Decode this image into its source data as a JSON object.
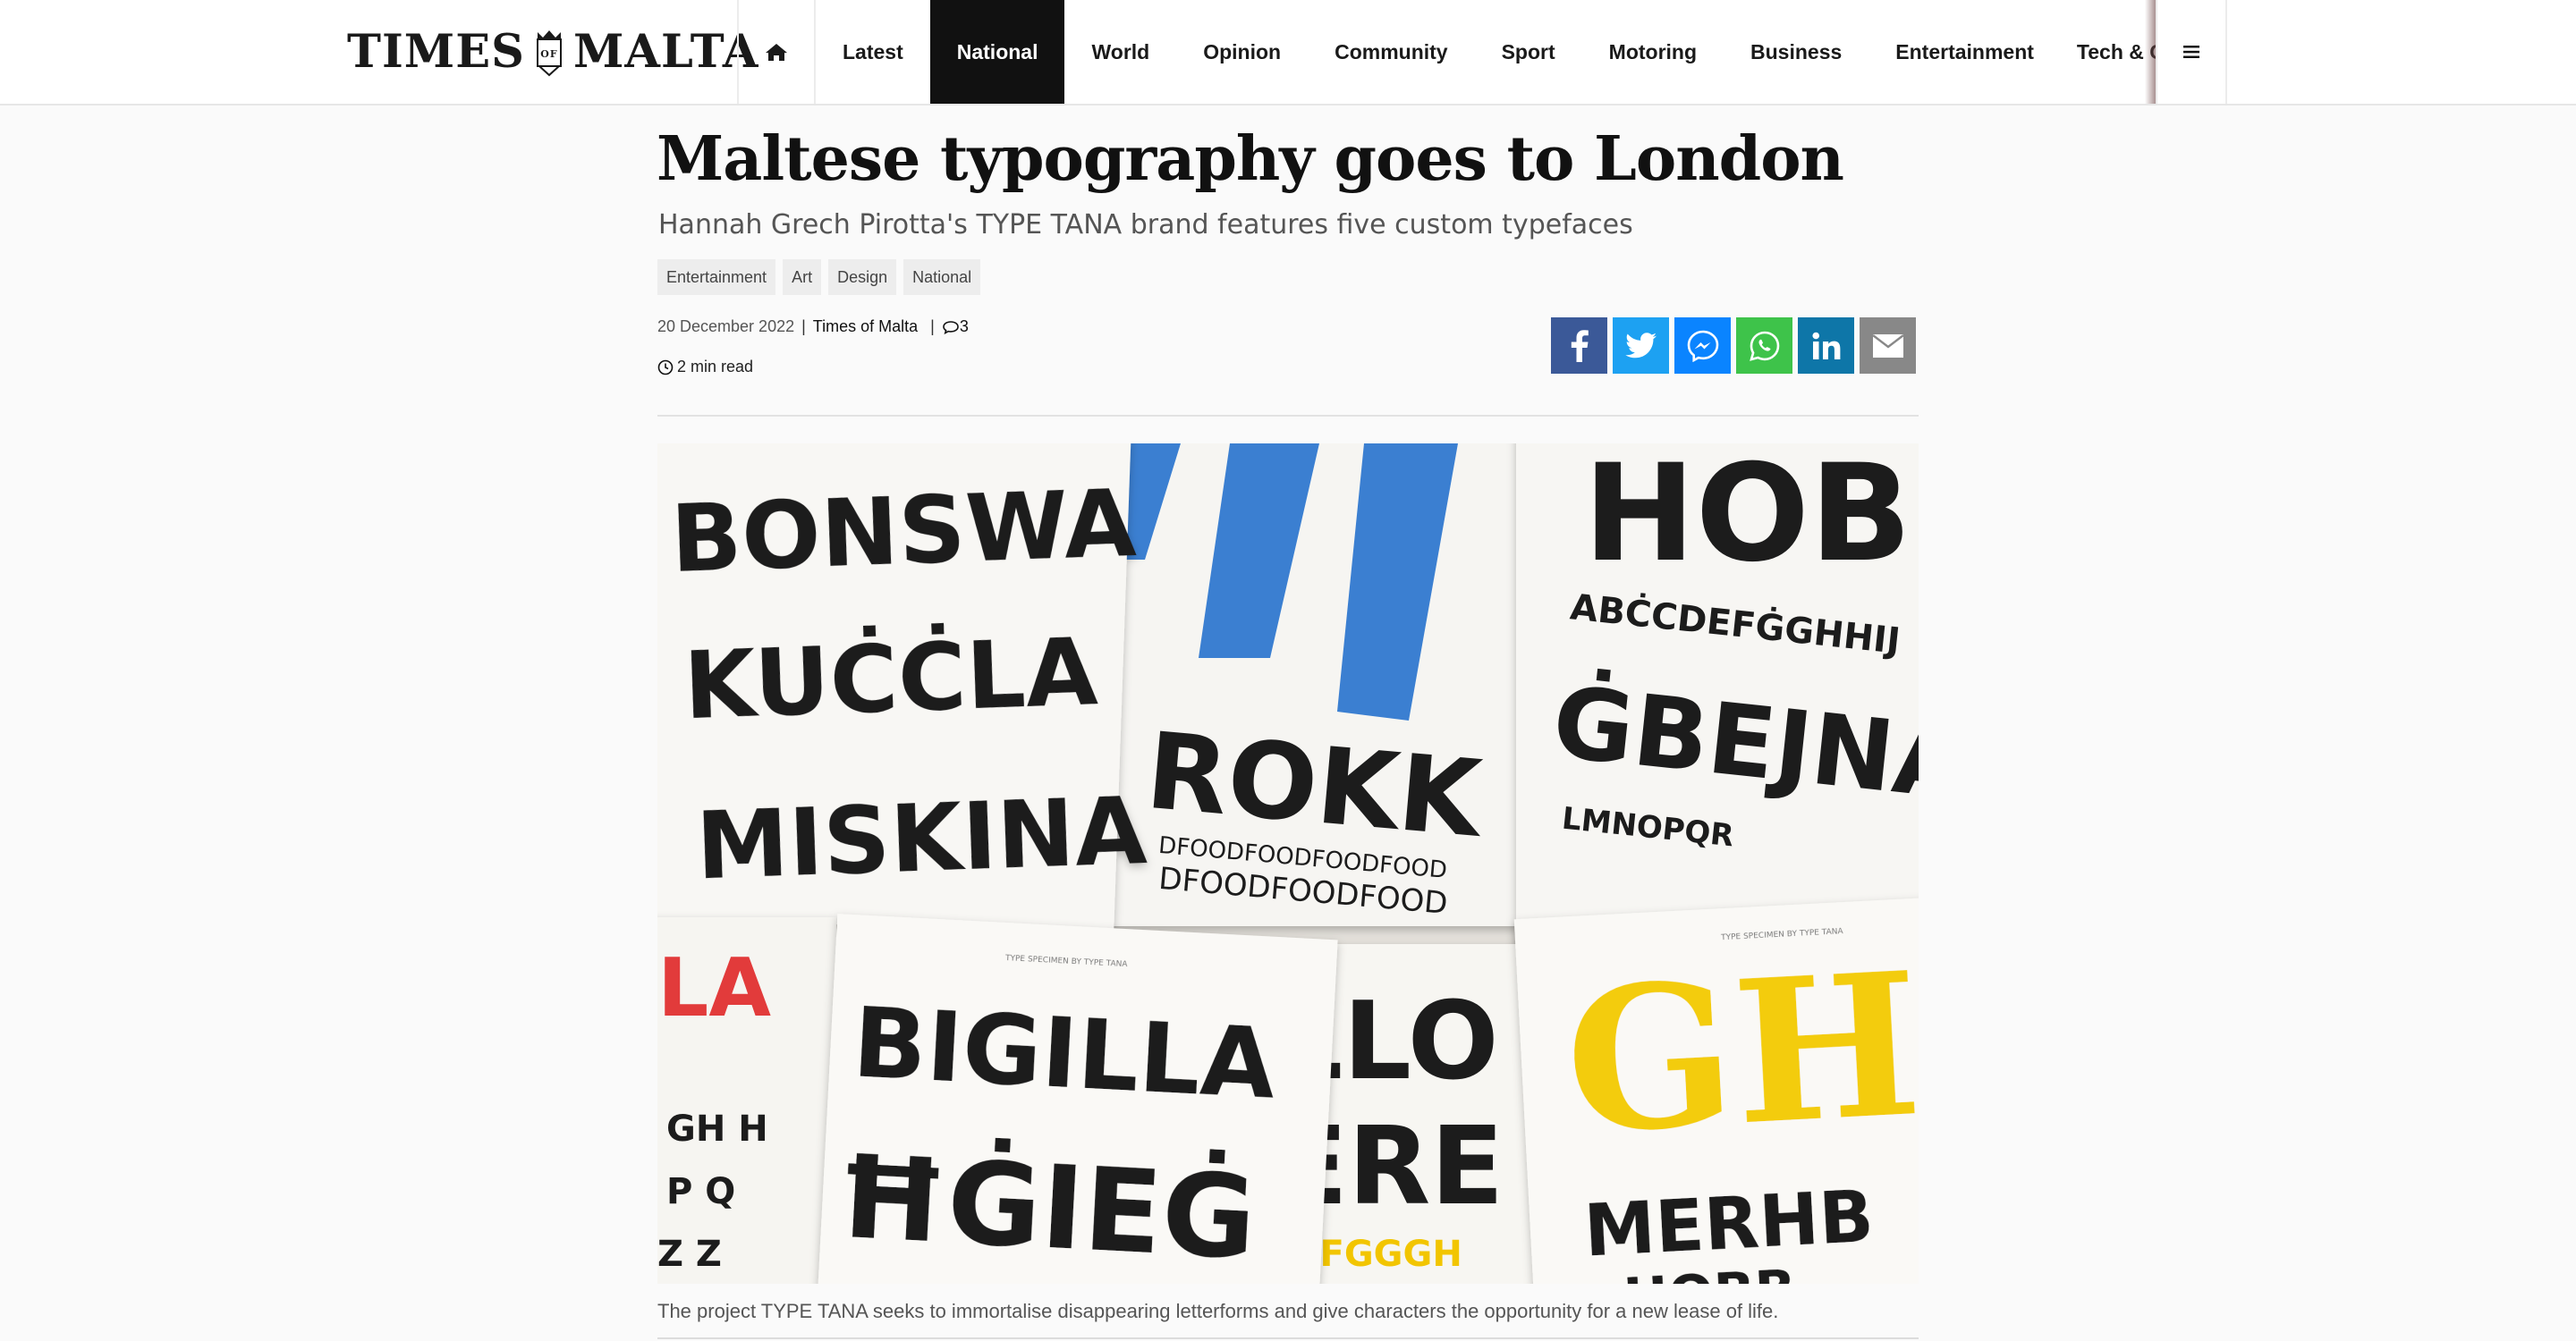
{
  "nav": {
    "logo_left": "TIMES",
    "logo_of": "OF",
    "logo_right": "MALTA",
    "items": [
      "Latest",
      "National",
      "World",
      "Opinion",
      "Community",
      "Sport",
      "Motoring",
      "Business",
      "Entertainment",
      "Tech & Gar"
    ],
    "active": "National"
  },
  "article": {
    "headline": "Maltese typography goes to London",
    "subhead": "Hannah Grech Pirotta's TYPE TANA brand features five custom typefaces",
    "tags": [
      "Entertainment",
      "Art",
      "Design",
      "National"
    ],
    "date": "20 December 2022",
    "author": "Times of Malta",
    "comments": "3",
    "read_time": "2 min read",
    "caption": "The project TYPE TANA seeks to immortalise disappearing letterforms and give characters the opportunity for a new lease of life."
  },
  "share_buttons": [
    {
      "name": "facebook",
      "color": "#3b5998"
    },
    {
      "name": "twitter",
      "color": "#1da1f2"
    },
    {
      "name": "messenger",
      "color": "#0a84ff"
    },
    {
      "name": "whatsapp",
      "color": "#3ec34a"
    },
    {
      "name": "linkedin",
      "color": "#0e76a8"
    },
    {
      "name": "email",
      "color": "#888888"
    }
  ],
  "hero_image": {
    "cards": {
      "bonswa": [
        "BONSWA",
        "KUĊĊLA",
        "MISKINA"
      ],
      "rokk": [
        "ROKK",
        "DFOODFOODFOODFOOD",
        "DFOODFOODFOOD"
      ],
      "hob": [
        "HOB",
        "ABĊCDEFĠGHHIJ",
        "ĠBEJNA",
        "LMNOPQR"
      ],
      "bigilla": [
        "BIGILLA",
        "ĦĠIEĠ",
        "TYPE SPECIMEN BY TYPE TANA"
      ],
      "left": [
        "LA",
        "GH H",
        "P Q",
        "Z Z"
      ],
      "lo": [
        "LLO",
        "ERE",
        "DEFGGGH"
      ],
      "gh": [
        "GH",
        "MERHB",
        "HOBB",
        "TYPE SPECIMEN BY TYPE TANA"
      ]
    }
  }
}
